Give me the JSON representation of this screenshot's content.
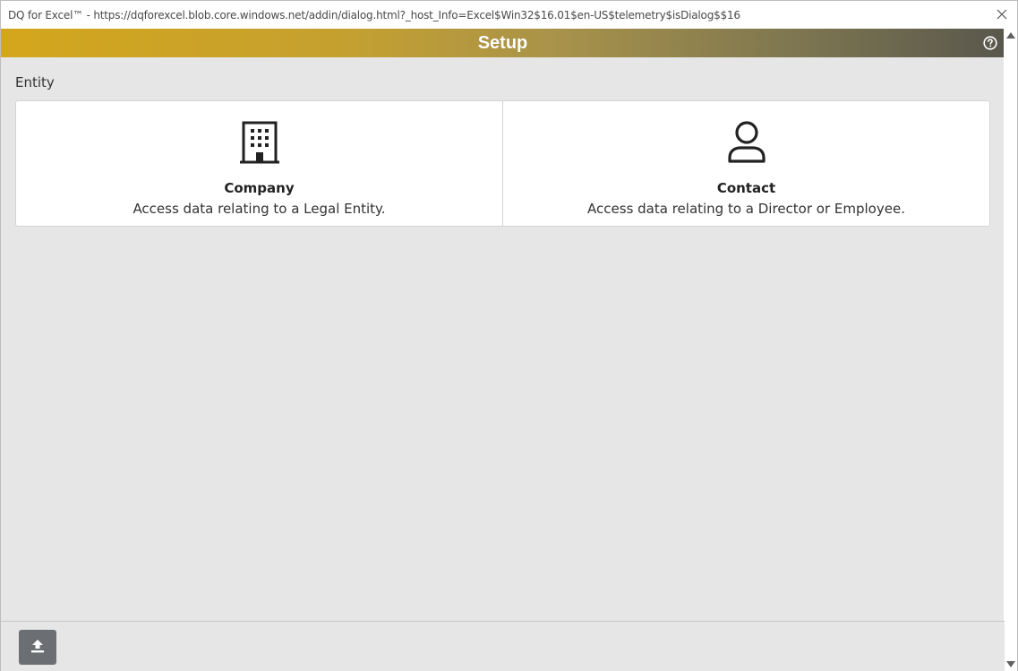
{
  "window": {
    "title": "DQ for Excel™ - https://dqforexcel.blob.core.windows.net/addin/dialog.html?_host_Info=Excel$Win32$16.01$en-US$telemetry$isDialog$$16"
  },
  "header": {
    "title": "Setup"
  },
  "entity": {
    "label": "Entity",
    "options": [
      {
        "title": "Company",
        "description": "Access data relating to a Legal Entity.",
        "icon": "building-icon"
      },
      {
        "title": "Contact",
        "description": "Access data relating to a Director or Employee.",
        "icon": "person-icon"
      }
    ]
  },
  "footer": {
    "upload_icon": "upload-icon"
  },
  "colors": {
    "header_start": "#d4a61c",
    "header_end": "#59574d",
    "button": "#6b6f73"
  }
}
